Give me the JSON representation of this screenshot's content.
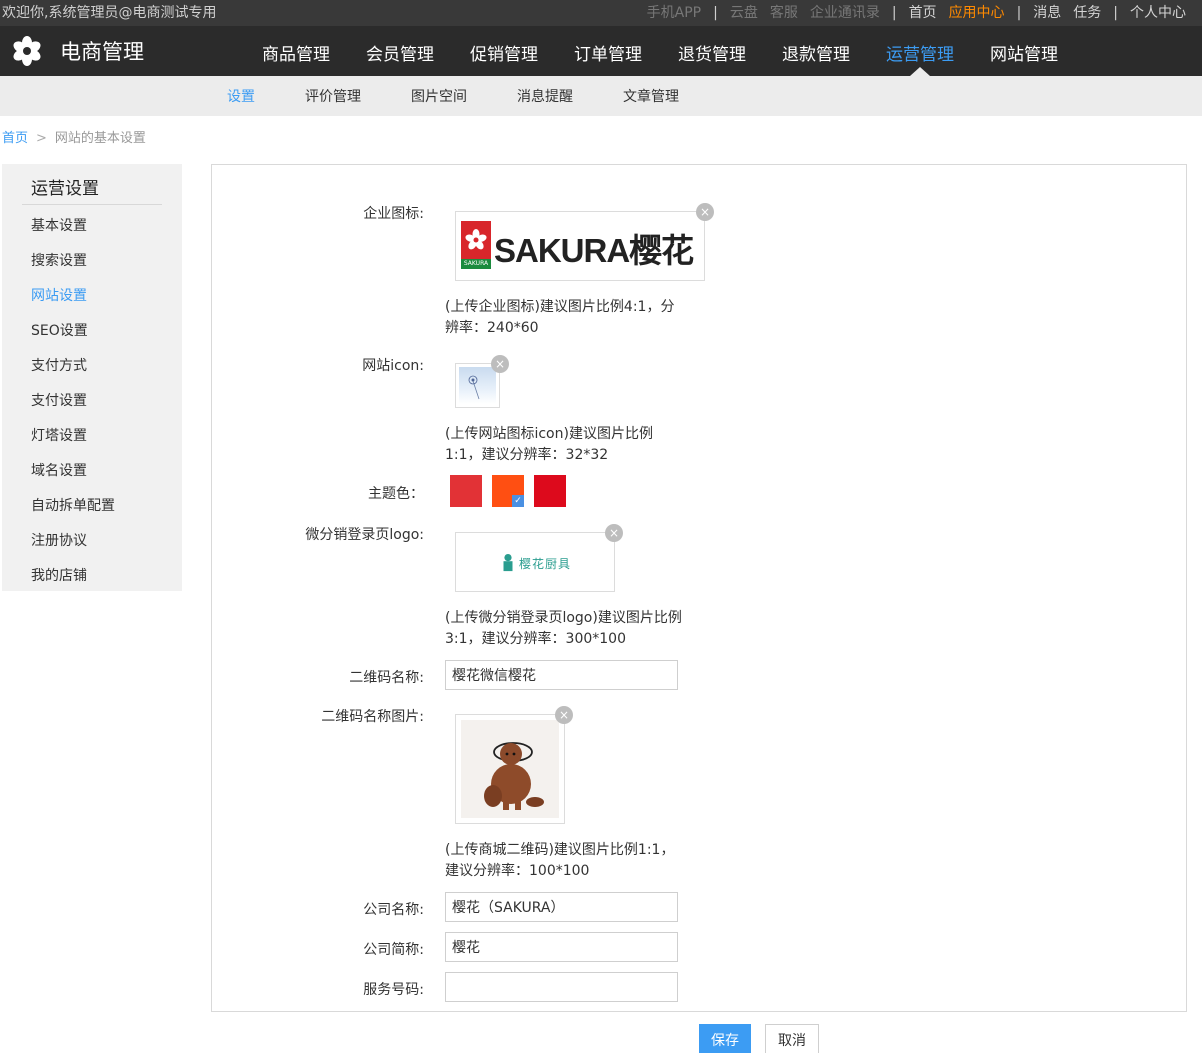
{
  "topbar": {
    "welcome": "欢迎你,系统管理员@电商测试专用",
    "links": [
      {
        "label": "手机APP",
        "state": "dim"
      },
      {
        "sep": "|"
      },
      {
        "label": "云盘",
        "state": "dim"
      },
      {
        "label": "客服",
        "state": "dim"
      },
      {
        "label": "企业通讯录",
        "state": "dim"
      },
      {
        "sep": "|"
      },
      {
        "label": "首页",
        "state": "lit"
      },
      {
        "label": "应用中心",
        "state": "active"
      },
      {
        "sep": "|"
      },
      {
        "label": "消息",
        "state": "lit"
      },
      {
        "label": "任务",
        "state": "lit"
      },
      {
        "sep": "|"
      },
      {
        "label": "个人中心",
        "state": "lit"
      }
    ]
  },
  "brand": {
    "name": "电商管理",
    "icon": "flower-logo-icon"
  },
  "mainnav": [
    {
      "label": "商品管理",
      "active": false
    },
    {
      "label": "会员管理",
      "active": false
    },
    {
      "label": "促销管理",
      "active": false
    },
    {
      "label": "订单管理",
      "active": false
    },
    {
      "label": "退货管理",
      "active": false
    },
    {
      "label": "退款管理",
      "active": false
    },
    {
      "label": "运营管理",
      "active": true
    },
    {
      "label": "网站管理",
      "active": false
    }
  ],
  "subnav": [
    {
      "label": "设置",
      "active": true
    },
    {
      "label": "评价管理",
      "active": false
    },
    {
      "label": "图片空间",
      "active": false
    },
    {
      "label": "消息提醒",
      "active": false
    },
    {
      "label": "文章管理",
      "active": false
    }
  ],
  "breadcrumb": {
    "home": "首页",
    "separator": ">",
    "current": "网站的基本设置"
  },
  "sidemenu": {
    "title": "运营设置",
    "items": [
      {
        "label": "基本设置",
        "active": false
      },
      {
        "label": "搜索设置",
        "active": false
      },
      {
        "label": "网站设置",
        "active": true
      },
      {
        "label": "SEO设置",
        "active": false
      },
      {
        "label": "支付方式",
        "active": false
      },
      {
        "label": "支付设置",
        "active": false
      },
      {
        "label": "灯塔设置",
        "active": false
      },
      {
        "label": "域名设置",
        "active": false
      },
      {
        "label": "自动拆单配置",
        "active": false
      },
      {
        "label": "注册协议",
        "active": false
      },
      {
        "label": "我的店铺",
        "active": false
      }
    ]
  },
  "form": {
    "company_logo": {
      "label": "企业图标:",
      "logo_text": "SAKURA樱花",
      "logo_badge": "SAKURA",
      "hint": "(上传企业图标)建议图片比例4:1，分辨率：240*60"
    },
    "site_icon": {
      "label": "网站icon:",
      "hint": "(上传网站图标icon)建议图片比例1:1，建议分辨率：32*32"
    },
    "theme_color": {
      "label": "主题色：",
      "colors": [
        "#e23236",
        "#ff4f12",
        "#dd0a1c"
      ],
      "selected_index": 1
    },
    "distribution_logo": {
      "label": "微分销登录页logo:",
      "logo_text": "樱花厨具",
      "hint": "(上传微分销登录页logo)建议图片比例3:1，建议分辨率：300*100"
    },
    "qrcode_name": {
      "label": "二维码名称:",
      "value": "樱花微信樱花"
    },
    "qrcode_image": {
      "label": "二维码名称图片:",
      "hint": "(上传商城二维码)建议图片比例1:1，建议分辨率：100*100"
    },
    "company_name": {
      "label": "公司名称:",
      "value": "樱花（SAKURA）"
    },
    "company_short": {
      "label": "公司简称:",
      "value": "樱花"
    },
    "service_phone": {
      "label": "服务号码:",
      "value": ""
    }
  },
  "buttons": {
    "save": "保存",
    "cancel": "取消"
  },
  "close_symbol": "×",
  "colors": {
    "accent": "#3c9cf3",
    "nav_bg": "#2b2b2b",
    "topbar_bg": "#393939",
    "orange": "#ff8a00"
  }
}
